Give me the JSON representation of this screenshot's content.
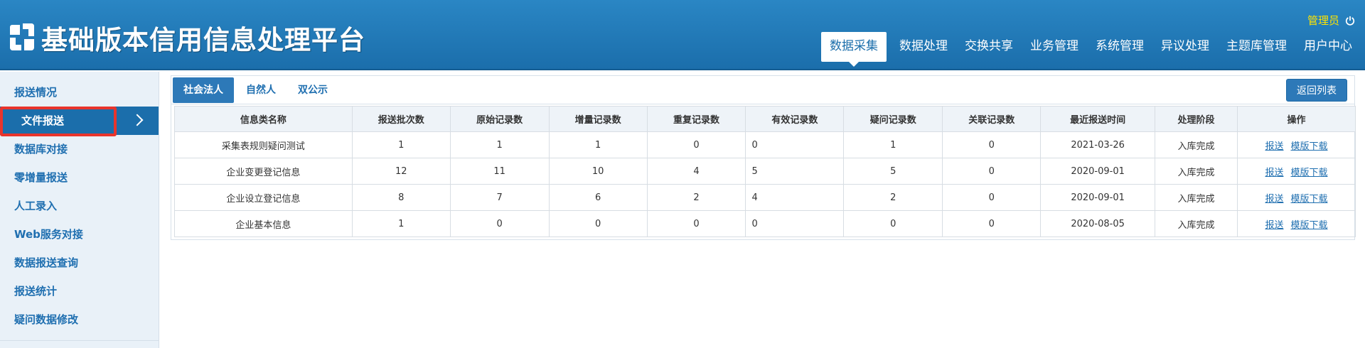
{
  "header": {
    "app_title": "基础版本信用信息处理平台",
    "admin_name": "管理员",
    "nav": [
      "数据采集",
      "数据处理",
      "交换共享",
      "业务管理",
      "系统管理",
      "异议处理",
      "主题库管理",
      "用户中心"
    ],
    "active_nav": "数据采集"
  },
  "sidebar": {
    "items": [
      "报送情况",
      "文件报送",
      "数据库对接",
      "零增量报送",
      "人工录入",
      "Web服务对接",
      "数据报送查询",
      "报送统计",
      "疑问数据修改"
    ],
    "active_item": "文件报送"
  },
  "tabs": {
    "items": [
      "社会法人",
      "自然人",
      "双公示"
    ],
    "active": "社会法人",
    "back_label": "返回列表"
  },
  "table": {
    "headers": [
      "信息类名称",
      "报送批次数",
      "原始记录数",
      "增量记录数",
      "重复记录数",
      "有效记录数",
      "疑问记录数",
      "关联记录数",
      "最近报送时间",
      "处理阶段",
      "操作"
    ],
    "rows": [
      [
        "采集表规则疑问测试",
        "1",
        "1",
        "1",
        "0",
        "0",
        "1",
        "0",
        "2021-03-26",
        "入库完成"
      ],
      [
        "企业变更登记信息",
        "12",
        "11",
        "10",
        "4",
        "5",
        "5",
        "0",
        "2020-09-01",
        "入库完成"
      ],
      [
        "企业设立登记信息",
        "8",
        "7",
        "6",
        "2",
        "4",
        "2",
        "0",
        "2020-09-01",
        "入库完成"
      ],
      [
        "企业基本信息",
        "1",
        "0",
        "0",
        "0",
        "0",
        "0",
        "0",
        "2020-08-05",
        "入库完成"
      ]
    ],
    "action_links": [
      "报送",
      "模版下载"
    ]
  },
  "colors": {
    "header_blue": "#1b6eab",
    "admin_yellow": "#ffe400",
    "highlight_red": "#e8342c"
  }
}
